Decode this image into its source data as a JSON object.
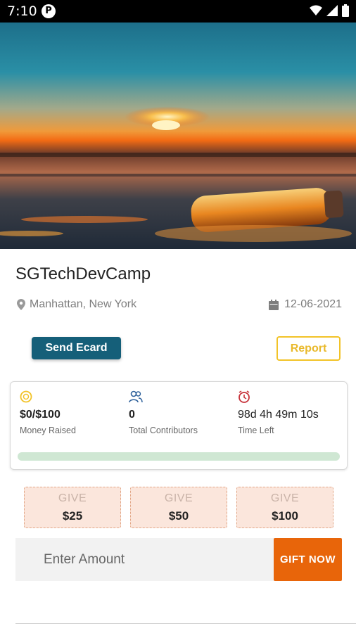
{
  "status_bar": {
    "time": "7:10",
    "icons": [
      "app-notification-icon",
      "wifi-icon",
      "signal-icon",
      "battery-icon"
    ]
  },
  "hero": {
    "image": "sunset-bottle-on-beach"
  },
  "campaign": {
    "title": "SGTechDevCamp",
    "location": "Manhattan, New York",
    "date": "12-06-2021"
  },
  "actions": {
    "send_ecard": "Send Ecard",
    "report": "Report"
  },
  "stats": {
    "money_raised_value": "$0/$100",
    "money_raised_label": "Money Raised",
    "contributors_value": "0",
    "contributors_label": "Total Contributors",
    "time_left_value": "98d 4h 49m 10s",
    "time_left_label": "Time Left",
    "progress_fraction": 0
  },
  "give_options": [
    {
      "label": "GIVE",
      "amount": "$25"
    },
    {
      "label": "GIVE",
      "amount": "$50"
    },
    {
      "label": "GIVE",
      "amount": "$100"
    }
  ],
  "gift": {
    "placeholder": "Enter Amount",
    "button": "GIFT NOW"
  },
  "colors": {
    "primary_button": "#155f79",
    "report_border": "#f2c328",
    "gift_button": "#e8650a",
    "give_bg": "#fbe6dc",
    "progress_track": "#cfe7d3"
  }
}
